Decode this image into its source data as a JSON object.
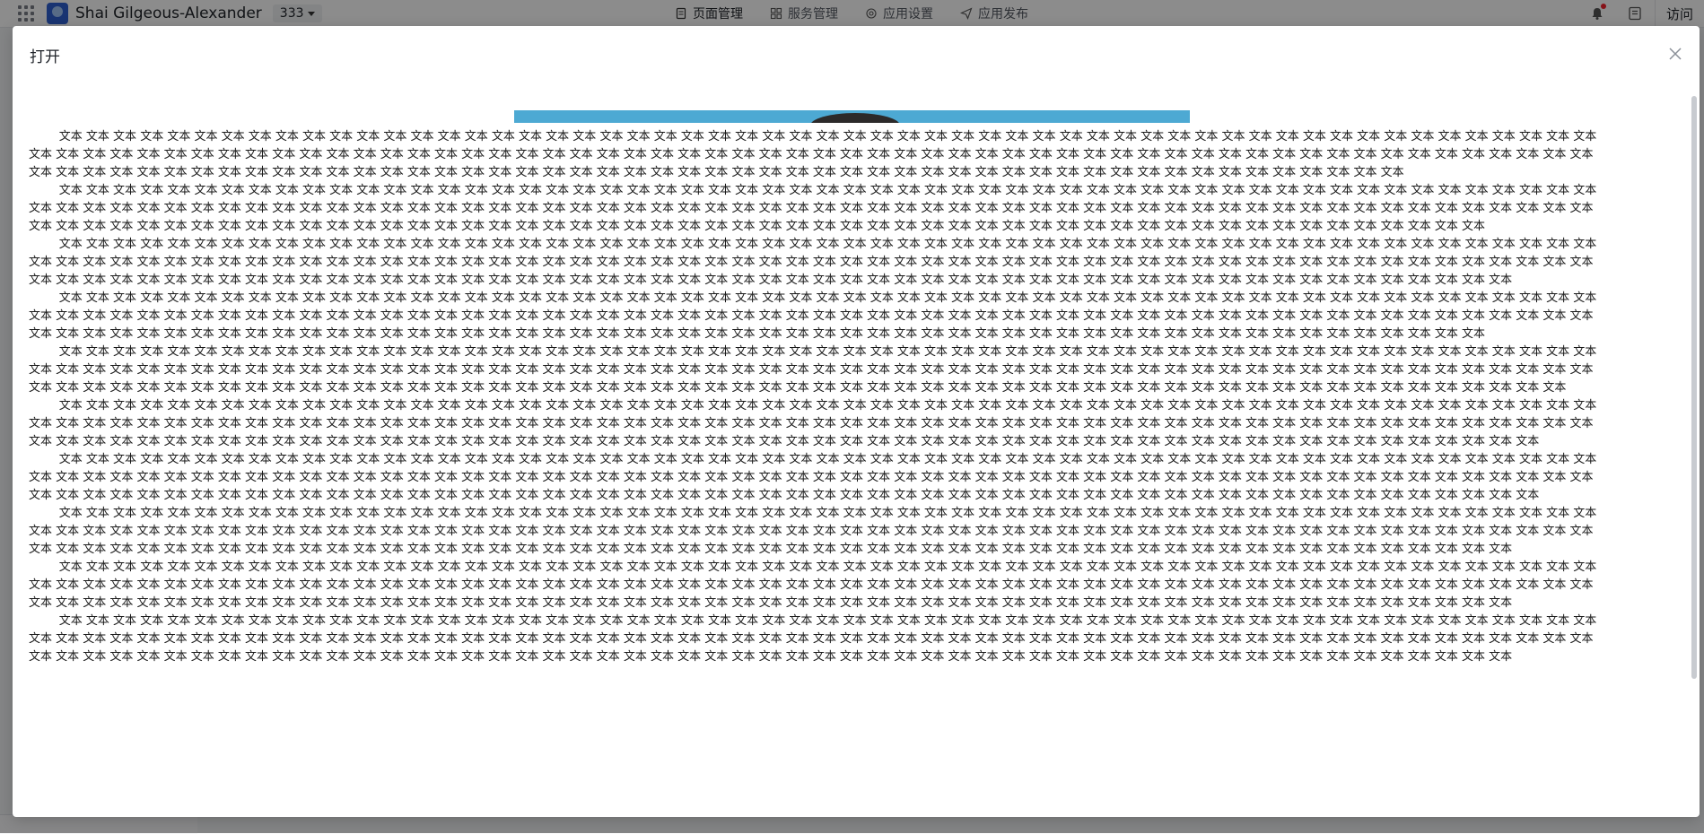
{
  "app": {
    "name": "Shai Gilgeous-Alexander",
    "version": "333",
    "nav": [
      {
        "label": "页面管理",
        "icon": "page-icon"
      },
      {
        "label": "服务管理",
        "icon": "services-icon"
      },
      {
        "label": "应用设置",
        "icon": "settings-icon"
      },
      {
        "label": "应用发布",
        "icon": "publish-icon"
      }
    ],
    "visit_label": "访问",
    "has_notification": true
  },
  "modal": {
    "title": "打开",
    "paragraphs": [
      "文本 文本 文本 文本 文本 文本 文本 文本 文本 文本 文本 文本 文本 文本 文本 文本 文本 文本 文本 文本 文本 文本 文本 文本 文本 文本 文本 文本 文本 文本 文本 文本 文本 文本 文本 文本 文本 文本 文本 文本 文本 文本 文本 文本 文本 文本 文本 文本 文本 文本 文本 文本 文本 文本 文本 文本 文本 文本 文本 文本 文本 文本 文本 文本 文本 文本 文本 文本 文本 文本 文本 文本 文本 文本 文本 文本 文本 文本 文本 文本 文本 文本 文本 文本 文本 文本 文本 文本 文本 文本 文本 文本 文本 文本 文本 文本 文本 文本 文本 文本 文本 文本 文本 文本 文本 文本 文本 文本 文本 文本 文本 文本 文本 文本 文本 文本 文本 文本 文本 文本 文本 文本 文本 文本 文本 文本 文本 文本 文本 文本 文本 文本 文本 文本 文本 文本 文本 文本 文本 文本 文本 文本 文本 文本 文本 文本 文本 文本 文本 文本 文本 文本 文本 文本 文本 文本 文本 文本 文本 文本 文本 文本 文本 文本 文本 文本",
      "文本 文本 文本 文本 文本 文本 文本 文本 文本 文本 文本 文本 文本 文本 文本 文本 文本 文本 文本 文本 文本 文本 文本 文本 文本 文本 文本 文本 文本 文本 文本 文本 文本 文本 文本 文本 文本 文本 文本 文本 文本 文本 文本 文本 文本 文本 文本 文本 文本 文本 文本 文本 文本 文本 文本 文本 文本 文本 文本 文本 文本 文本 文本 文本 文本 文本 文本 文本 文本 文本 文本 文本 文本 文本 文本 文本 文本 文本 文本 文本 文本 文本 文本 文本 文本 文本 文本 文本 文本 文本 文本 文本 文本 文本 文本 文本 文本 文本 文本 文本 文本 文本 文本 文本 文本 文本 文本 文本 文本 文本 文本 文本 文本 文本 文本 文本 文本 文本 文本 文本 文本 文本 文本 文本 文本 文本 文本 文本 文本 文本 文本 文本 文本 文本 文本 文本 文本 文本 文本 文本 文本 文本 文本 文本 文本 文本 文本 文本 文本 文本 文本 文本 文本 文本 文本 文本 文本 文本 文本 文本 文本 文本 文本 文本 文本 文本 文本 文本 文本",
      "文本 文本 文本 文本 文本 文本 文本 文本 文本 文本 文本 文本 文本 文本 文本 文本 文本 文本 文本 文本 文本 文本 文本 文本 文本 文本 文本 文本 文本 文本 文本 文本 文本 文本 文本 文本 文本 文本 文本 文本 文本 文本 文本 文本 文本 文本 文本 文本 文本 文本 文本 文本 文本 文本 文本 文本 文本 文本 文本 文本 文本 文本 文本 文本 文本 文本 文本 文本 文本 文本 文本 文本 文本 文本 文本 文本 文本 文本 文本 文本 文本 文本 文本 文本 文本 文本 文本 文本 文本 文本 文本 文本 文本 文本 文本 文本 文本 文本 文本 文本 文本 文本 文本 文本 文本 文本 文本 文本 文本 文本 文本 文本 文本 文本 文本 文本 文本 文本 文本 文本 文本 文本 文本 文本 文本 文本 文本 文本 文本 文本 文本 文本 文本 文本 文本 文本 文本 文本 文本 文本 文本 文本 文本 文本 文本 文本 文本 文本 文本 文本 文本 文本 文本 文本 文本 文本 文本 文本 文本 文本 文本 文本 文本 文本 文本 文本 文本 文本 文本 文本",
      "文本 文本 文本 文本 文本 文本 文本 文本 文本 文本 文本 文本 文本 文本 文本 文本 文本 文本 文本 文本 文本 文本 文本 文本 文本 文本 文本 文本 文本 文本 文本 文本 文本 文本 文本 文本 文本 文本 文本 文本 文本 文本 文本 文本 文本 文本 文本 文本 文本 文本 文本 文本 文本 文本 文本 文本 文本 文本 文本 文本 文本 文本 文本 文本 文本 文本 文本 文本 文本 文本 文本 文本 文本 文本 文本 文本 文本 文本 文本 文本 文本 文本 文本 文本 文本 文本 文本 文本 文本 文本 文本 文本 文本 文本 文本 文本 文本 文本 文本 文本 文本 文本 文本 文本 文本 文本 文本 文本 文本 文本 文本 文本 文本 文本 文本 文本 文本 文本 文本 文本 文本 文本 文本 文本 文本 文本 文本 文本 文本 文本 文本 文本 文本 文本 文本 文本 文本 文本 文本 文本 文本 文本 文本 文本 文本 文本 文本 文本 文本 文本 文本 文本 文本 文本 文本 文本 文本 文本 文本 文本 文本 文本 文本 文本 文本 文本 文本 文本 文本",
      "文本 文本 文本 文本 文本 文本 文本 文本 文本 文本 文本 文本 文本 文本 文本 文本 文本 文本 文本 文本 文本 文本 文本 文本 文本 文本 文本 文本 文本 文本 文本 文本 文本 文本 文本 文本 文本 文本 文本 文本 文本 文本 文本 文本 文本 文本 文本 文本 文本 文本 文本 文本 文本 文本 文本 文本 文本 文本 文本 文本 文本 文本 文本 文本 文本 文本 文本 文本 文本 文本 文本 文本 文本 文本 文本 文本 文本 文本 文本 文本 文本 文本 文本 文本 文本 文本 文本 文本 文本 文本 文本 文本 文本 文本 文本 文本 文本 文本 文本 文本 文本 文本 文本 文本 文本 文本 文本 文本 文本 文本 文本 文本 文本 文本 文本 文本 文本 文本 文本 文本 文本 文本 文本 文本 文本 文本 文本 文本 文本 文本 文本 文本 文本 文本 文本 文本 文本 文本 文本 文本 文本 文本 文本 文本 文本 文本 文本 文本 文本 文本 文本 文本 文本 文本 文本 文本 文本 文本 文本 文本 文本 文本 文本 文本 文本 文本 文本 文本 文本 文本 文本 文本",
      "文本 文本 文本 文本 文本 文本 文本 文本 文本 文本 文本 文本 文本 文本 文本 文本 文本 文本 文本 文本 文本 文本 文本 文本 文本 文本 文本 文本 文本 文本 文本 文本 文本 文本 文本 文本 文本 文本 文本 文本 文本 文本 文本 文本 文本 文本 文本 文本 文本 文本 文本 文本 文本 文本 文本 文本 文本 文本 文本 文本 文本 文本 文本 文本 文本 文本 文本 文本 文本 文本 文本 文本 文本 文本 文本 文本 文本 文本 文本 文本 文本 文本 文本 文本 文本 文本 文本 文本 文本 文本 文本 文本 文本 文本 文本 文本 文本 文本 文本 文本 文本 文本 文本 文本 文本 文本 文本 文本 文本 文本 文本 文本 文本 文本 文本 文本 文本 文本 文本 文本 文本 文本 文本 文本 文本 文本 文本 文本 文本 文本 文本 文本 文本 文本 文本 文本 文本 文本 文本 文本 文本 文本 文本 文本 文本 文本 文本 文本 文本 文本 文本 文本 文本 文本 文本 文本 文本 文本 文本 文本 文本 文本 文本 文本 文本 文本 文本 文本 文本 文本 文本",
      "文本 文本 文本 文本 文本 文本 文本 文本 文本 文本 文本 文本 文本 文本 文本 文本 文本 文本 文本 文本 文本 文本 文本 文本 文本 文本 文本 文本 文本 文本 文本 文本 文本 文本 文本 文本 文本 文本 文本 文本 文本 文本 文本 文本 文本 文本 文本 文本 文本 文本 文本 文本 文本 文本 文本 文本 文本 文本 文本 文本 文本 文本 文本 文本 文本 文本 文本 文本 文本 文本 文本 文本 文本 文本 文本 文本 文本 文本 文本 文本 文本 文本 文本 文本 文本 文本 文本 文本 文本 文本 文本 文本 文本 文本 文本 文本 文本 文本 文本 文本 文本 文本 文本 文本 文本 文本 文本 文本 文本 文本 文本 文本 文本 文本 文本 文本 文本 文本 文本 文本 文本 文本 文本 文本 文本 文本 文本 文本 文本 文本 文本 文本 文本 文本 文本 文本 文本 文本 文本 文本 文本 文本 文本 文本 文本 文本 文本 文本 文本 文本 文本 文本 文本 文本 文本 文本 文本 文本 文本 文本 文本 文本 文本 文本 文本 文本 文本 文本 文本 文本 文本",
      "文本 文本 文本 文本 文本 文本 文本 文本 文本 文本 文本 文本 文本 文本 文本 文本 文本 文本 文本 文本 文本 文本 文本 文本 文本 文本 文本 文本 文本 文本 文本 文本 文本 文本 文本 文本 文本 文本 文本 文本 文本 文本 文本 文本 文本 文本 文本 文本 文本 文本 文本 文本 文本 文本 文本 文本 文本 文本 文本 文本 文本 文本 文本 文本 文本 文本 文本 文本 文本 文本 文本 文本 文本 文本 文本 文本 文本 文本 文本 文本 文本 文本 文本 文本 文本 文本 文本 文本 文本 文本 文本 文本 文本 文本 文本 文本 文本 文本 文本 文本 文本 文本 文本 文本 文本 文本 文本 文本 文本 文本 文本 文本 文本 文本 文本 文本 文本 文本 文本 文本 文本 文本 文本 文本 文本 文本 文本 文本 文本 文本 文本 文本 文本 文本 文本 文本 文本 文本 文本 文本 文本 文本 文本 文本 文本 文本 文本 文本 文本 文本 文本 文本 文本 文本 文本 文本 文本 文本 文本 文本 文本 文本 文本 文本 文本 文本 文本 文本 文本 文本",
      "文本 文本 文本 文本 文本 文本 文本 文本 文本 文本 文本 文本 文本 文本 文本 文本 文本 文本 文本 文本 文本 文本 文本 文本 文本 文本 文本 文本 文本 文本 文本 文本 文本 文本 文本 文本 文本 文本 文本 文本 文本 文本 文本 文本 文本 文本 文本 文本 文本 文本 文本 文本 文本 文本 文本 文本 文本 文本 文本 文本 文本 文本 文本 文本 文本 文本 文本 文本 文本 文本 文本 文本 文本 文本 文本 文本 文本 文本 文本 文本 文本 文本 文本 文本 文本 文本 文本 文本 文本 文本 文本 文本 文本 文本 文本 文本 文本 文本 文本 文本 文本 文本 文本 文本 文本 文本 文本 文本 文本 文本 文本 文本 文本 文本 文本 文本 文本 文本 文本 文本 文本 文本 文本 文本 文本 文本 文本 文本 文本 文本 文本 文本 文本 文本 文本 文本 文本 文本 文本 文本 文本 文本 文本 文本 文本 文本 文本 文本 文本 文本 文本 文本 文本 文本 文本 文本 文本 文本 文本 文本 文本 文本 文本 文本 文本 文本 文本 文本 文本 文本",
      "文本 文本 文本 文本 文本 文本 文本 文本 文本 文本 文本 文本 文本 文本 文本 文本 文本 文本 文本 文本 文本 文本 文本 文本 文本 文本 文本 文本 文本 文本 文本 文本 文本 文本 文本 文本 文本 文本 文本 文本 文本 文本 文本 文本 文本 文本 文本 文本 文本 文本 文本 文本 文本 文本 文本 文本 文本 文本 文本 文本 文本 文本 文本 文本 文本 文本 文本 文本 文本 文本 文本 文本 文本 文本 文本 文本 文本 文本 文本 文本 文本 文本 文本 文本 文本 文本 文本 文本 文本 文本 文本 文本 文本 文本 文本 文本 文本 文本 文本 文本 文本 文本 文本 文本 文本 文本 文本 文本 文本 文本 文本 文本 文本 文本 文本 文本 文本 文本 文本 文本 文本 文本 文本 文本 文本 文本 文本 文本 文本 文本 文本 文本 文本 文本 文本 文本 文本 文本 文本 文本 文本 文本 文本 文本 文本 文本 文本 文本 文本 文本 文本 文本 文本 文本 文本 文本 文本 文本 文本 文本 文本 文本 文本 文本 文本 文本 文本 文本 文本 文本"
    ]
  },
  "colors": {
    "accent": "#2f5fd0",
    "banner": "#4da9d3",
    "notification": "#f5222d"
  }
}
